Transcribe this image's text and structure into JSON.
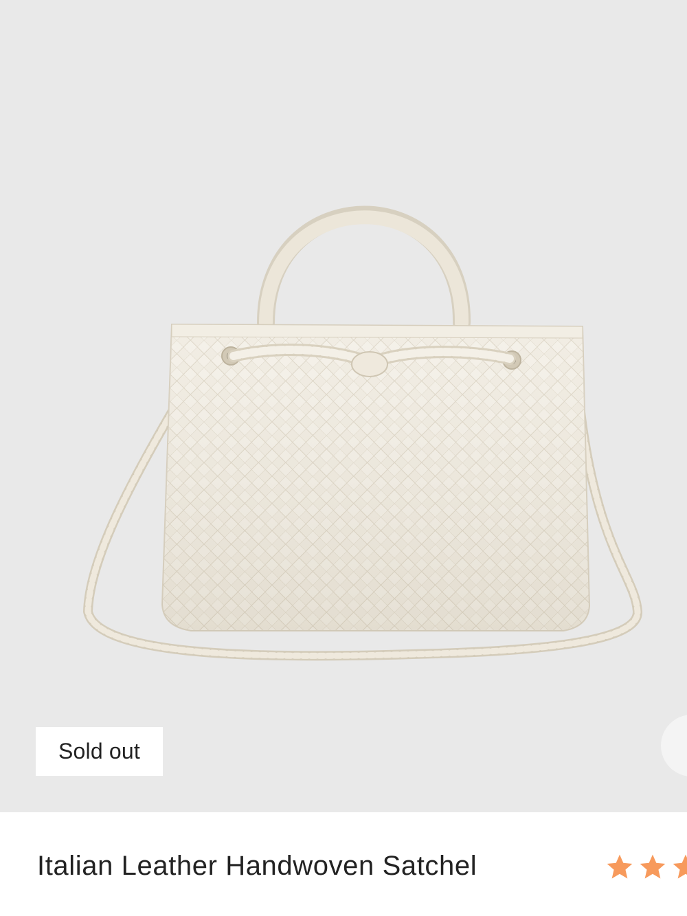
{
  "product": {
    "title": "Italian Leather Handwoven Satchel",
    "badge": "Sold out",
    "image": {
      "icon": "woven-satchel-bag-image",
      "bag_color": "#ece6d8",
      "background_color": "#e9e9e9"
    },
    "rating": {
      "visible_stars": 3,
      "star_color": "#f79a5c",
      "icon": "star-icon"
    }
  },
  "carousel": {
    "next_icon": "next-arrow-icon"
  }
}
